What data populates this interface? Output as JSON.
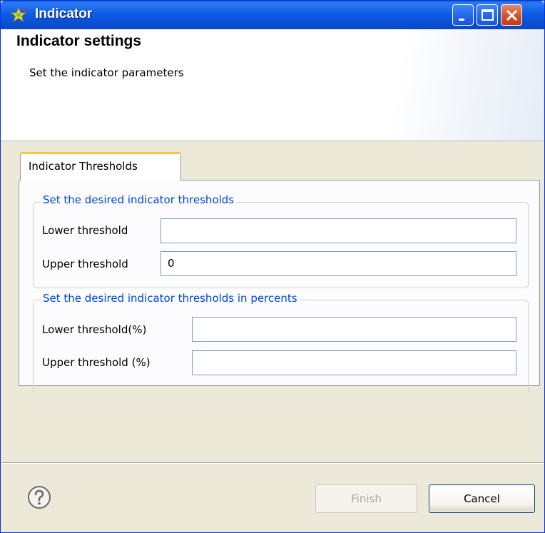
{
  "window": {
    "title": "Indicator"
  },
  "banner": {
    "title": "Indicator settings",
    "description": "Set the indicator parameters"
  },
  "tabs": [
    {
      "label": "Indicator Thresholds",
      "selected": true
    }
  ],
  "groups": [
    {
      "legend": "Set the desired indicator thresholds",
      "fields": [
        {
          "label": "Lower threshold",
          "value": ""
        },
        {
          "label": "Upper threshold",
          "value": "0"
        }
      ]
    },
    {
      "legend": "Set the desired indicator thresholds in percents",
      "fields": [
        {
          "label": "Lower threshold(%)",
          "value": ""
        },
        {
          "label": "Upper threshold (%)",
          "value": ""
        }
      ]
    }
  ],
  "footer": {
    "help_icon": "question-mark-circle",
    "finish_label": "Finish",
    "finish_enabled": false,
    "cancel_label": "Cancel"
  },
  "colors": {
    "titlebar": "#0a5fd8",
    "group_legend": "#0046d5",
    "tab_accent": "#ffc83c",
    "dialog_bg": "#ece9d8"
  }
}
